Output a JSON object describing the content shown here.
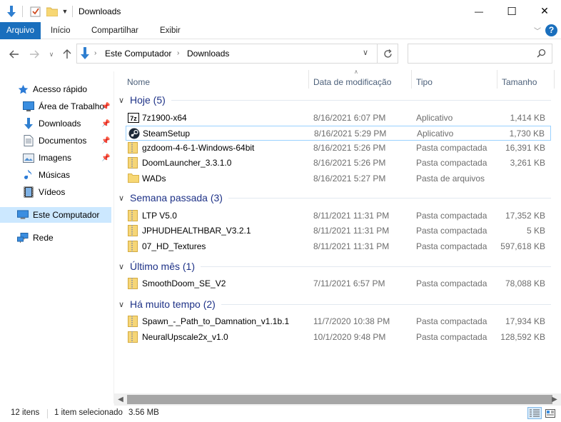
{
  "window": {
    "title": "Downloads",
    "controls": {
      "minimize": "—",
      "maximize": "☐",
      "close": "✕"
    }
  },
  "ribbon": {
    "tabs": [
      "Arquivo",
      "Início",
      "Compartilhar",
      "Exibir"
    ],
    "help": "?"
  },
  "address": {
    "path": [
      "Este Computador",
      "Downloads"
    ],
    "search_placeholder": ""
  },
  "sidebar": {
    "items": [
      {
        "label": "Acesso rápido",
        "icon": "star-icon",
        "pinned": false
      },
      {
        "label": "Área de Trabalho",
        "icon": "desktop-icon",
        "pinned": true
      },
      {
        "label": "Downloads",
        "icon": "download-icon",
        "pinned": true
      },
      {
        "label": "Documentos",
        "icon": "document-icon",
        "pinned": true
      },
      {
        "label": "Imagens",
        "icon": "pictures-icon",
        "pinned": true
      },
      {
        "label": "Músicas",
        "icon": "music-icon",
        "pinned": false
      },
      {
        "label": "Vídeos",
        "icon": "video-icon",
        "pinned": false
      },
      {
        "label": "Este Computador",
        "icon": "computer-icon",
        "pinned": false
      },
      {
        "label": "Rede",
        "icon": "network-icon",
        "pinned": false
      }
    ]
  },
  "columns": [
    "Nome",
    "Data de modificação",
    "Tipo",
    "Tamanho"
  ],
  "groups": [
    {
      "label": "Hoje (5)",
      "files": [
        {
          "name": "7z1900-x64",
          "date": "8/16/2021 6:07 PM",
          "type": "Aplicativo",
          "size": "1,414 KB",
          "icon": "7zip-icon"
        },
        {
          "name": "SteamSetup",
          "date": "8/16/2021 5:29 PM",
          "type": "Aplicativo",
          "size": "1,730 KB",
          "icon": "steam-icon"
        },
        {
          "name": "gzdoom-4-6-1-Windows-64bit",
          "date": "8/16/2021 5:26 PM",
          "type": "Pasta compactada",
          "size": "16,391 KB",
          "icon": "zip-folder-icon"
        },
        {
          "name": "DoomLauncher_3.3.1.0",
          "date": "8/16/2021 5:26 PM",
          "type": "Pasta compactada",
          "size": "3,261 KB",
          "icon": "zip-folder-icon"
        },
        {
          "name": "WADs",
          "date": "8/16/2021 5:27 PM",
          "type": "Pasta de arquivos",
          "size": "",
          "icon": "folder-icon"
        }
      ]
    },
    {
      "label": "Semana passada (3)",
      "files": [
        {
          "name": "LTP V5.0",
          "date": "8/11/2021 11:31 PM",
          "type": "Pasta compactada",
          "size": "17,352 KB",
          "icon": "zip-folder-icon"
        },
        {
          "name": "JPHUDHEALTHBAR_V3.2.1",
          "date": "8/11/2021 11:31 PM",
          "type": "Pasta compactada",
          "size": "5 KB",
          "icon": "zip-folder-icon"
        },
        {
          "name": "07_HD_Textures",
          "date": "8/11/2021 11:31 PM",
          "type": "Pasta compactada",
          "size": "597,618 KB",
          "icon": "zip-folder-icon"
        }
      ]
    },
    {
      "label": "Último mês (1)",
      "files": [
        {
          "name": "SmoothDoom_SE_V2",
          "date": "7/11/2021 6:57 PM",
          "type": "Pasta compactada",
          "size": "78,088 KB",
          "icon": "zip-folder-icon"
        }
      ]
    },
    {
      "label": "Há muito tempo (2)",
      "files": [
        {
          "name": "Spawn_-_Path_to_Damnation_v1.1b.1",
          "date": "11/7/2020 10:38 PM",
          "type": "Pasta compactada",
          "size": "17,934 KB",
          "icon": "zip-folder-icon"
        },
        {
          "name": "NeuralUpscale2x_v1.0",
          "date": "10/1/2020 9:48 PM",
          "type": "Pasta compactada",
          "size": "128,592 KB",
          "icon": "zip-folder-icon"
        }
      ]
    }
  ],
  "selected_file": "SteamSetup",
  "status": {
    "item_count": "12 itens",
    "selection": "1 item selecionado",
    "selection_size": "3.56 MB"
  },
  "colors": {
    "accent": "#1a6fbd",
    "group_header": "#1e3287",
    "selection_border": "#99d1ff",
    "sidebar_selection": "#cce8ff"
  }
}
